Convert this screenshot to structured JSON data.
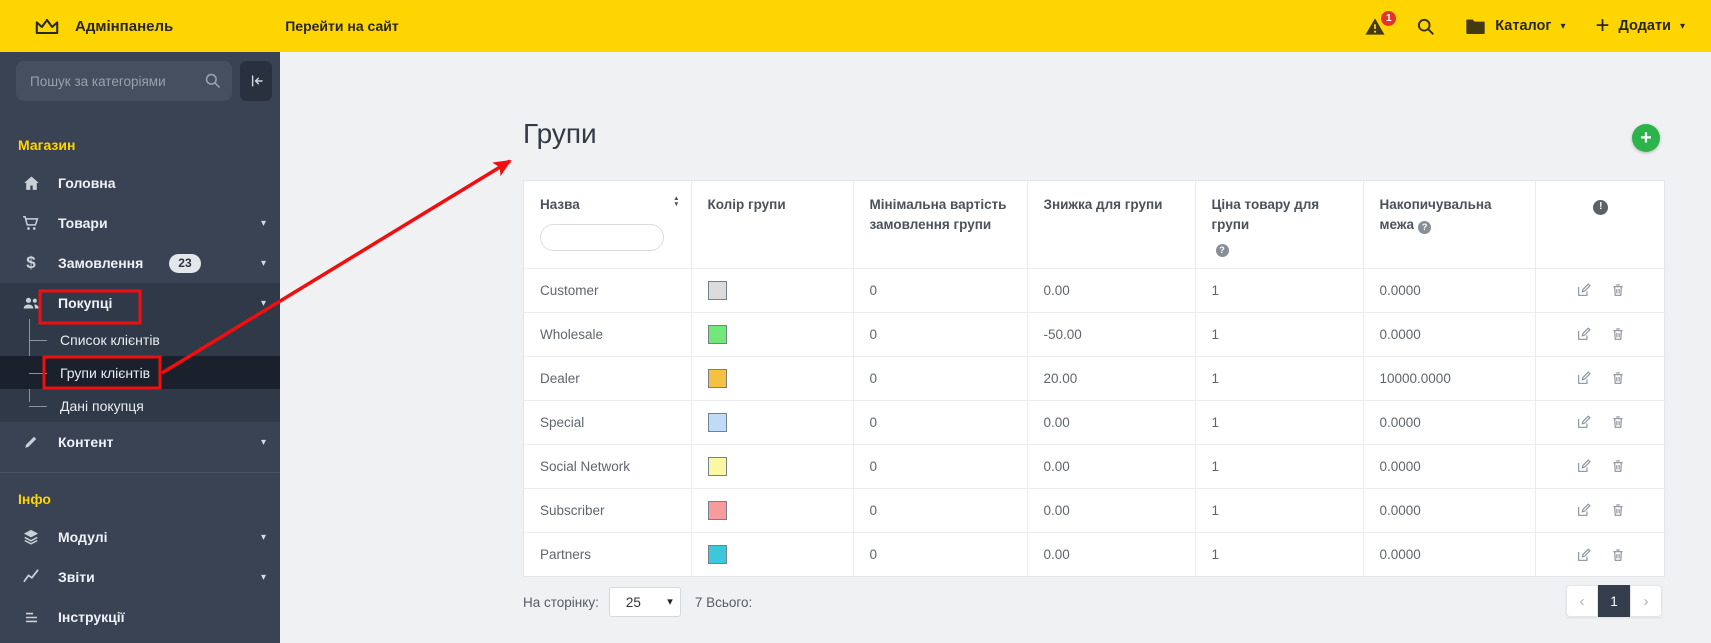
{
  "topbar": {
    "brand": "Адмінпанель",
    "go_to_site": "Перейти на сайт",
    "alerts_count": "1",
    "catalog": "Каталог",
    "add": "Додати"
  },
  "sidebar": {
    "search_placeholder": "Пошук за категоріями",
    "section_store": "Магазин",
    "section_info": "Інфо",
    "home": "Головна",
    "products": "Товари",
    "orders": "Замовлення",
    "orders_badge": "23",
    "customers": "Покупці",
    "customers_sub": [
      "Список клієнтів",
      "Групи клієнтів",
      "Дані покупця"
    ],
    "content": "Контент",
    "modules": "Модулі",
    "reports": "Звіти",
    "instructions": "Інструкції"
  },
  "main": {
    "title": "Групи",
    "accent_green": "#2CB44A"
  },
  "table": {
    "col_name": "Назва",
    "col_color": "Колір групи",
    "col_min_order": "Мінімальна вартість замовлення групи",
    "col_discount": "Знижка для групи",
    "col_price": "Ціна товару для групи",
    "col_limit": "Накопичувальна межа",
    "rows": [
      {
        "name": "Customer",
        "color": "#dcdcdc",
        "min_order": "0",
        "discount": "0.00",
        "price": "1",
        "limit": "0.0000"
      },
      {
        "name": "Wholesale",
        "color": "#71e87a",
        "min_order": "0",
        "discount": "-50.00",
        "price": "1",
        "limit": "0.0000"
      },
      {
        "name": "Dealer",
        "color": "#f5c140",
        "min_order": "0",
        "discount": "20.00",
        "price": "1",
        "limit": "10000.0000"
      },
      {
        "name": "Special",
        "color": "#bedcf8",
        "min_order": "0",
        "discount": "0.00",
        "price": "1",
        "limit": "0.0000"
      },
      {
        "name": "Social Network",
        "color": "#fcf7a3",
        "min_order": "0",
        "discount": "0.00",
        "price": "1",
        "limit": "0.0000"
      },
      {
        "name": "Subscriber",
        "color": "#f69c9c",
        "min_order": "0",
        "discount": "0.00",
        "price": "1",
        "limit": "0.0000"
      },
      {
        "name": "Partners",
        "color": "#3cc8dc",
        "min_order": "0",
        "discount": "0.00",
        "price": "1",
        "limit": "0.0000"
      }
    ]
  },
  "footer": {
    "per_page_label": "На сторінку:",
    "per_page_value": "25",
    "total": "7 Всього:",
    "page": "1"
  },
  "annotations": {
    "color": "#f10e0e"
  }
}
